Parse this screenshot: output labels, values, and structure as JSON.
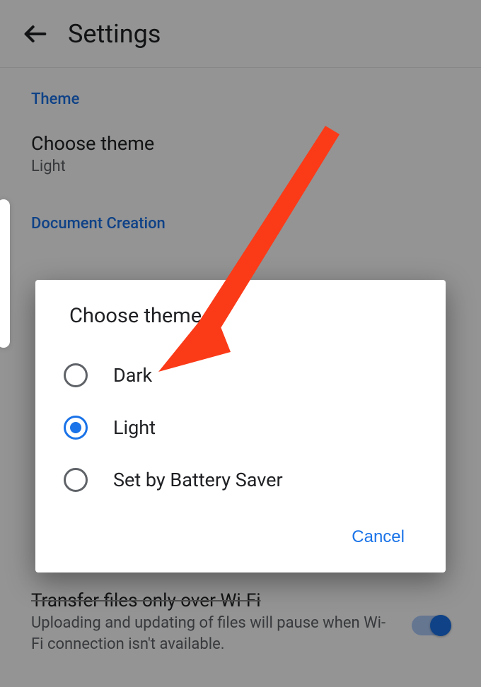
{
  "header": {
    "title": "Settings"
  },
  "sections": {
    "theme": {
      "header": "Theme",
      "choose_label": "Choose theme",
      "choose_value": "Light"
    },
    "doc": {
      "header": "Document Creation"
    }
  },
  "bottom_pref": {
    "title": "Transfer files only over Wi-Fi",
    "subtitle": "Uploading and updating of files will pause when Wi-Fi connection isn't available."
  },
  "dialog": {
    "title": "Choose theme",
    "options": {
      "0": {
        "label": "Dark",
        "selected": false
      },
      "1": {
        "label": "Light",
        "selected": true
      },
      "2": {
        "label": "Set by Battery Saver",
        "selected": false
      }
    },
    "cancel": "Cancel"
  }
}
